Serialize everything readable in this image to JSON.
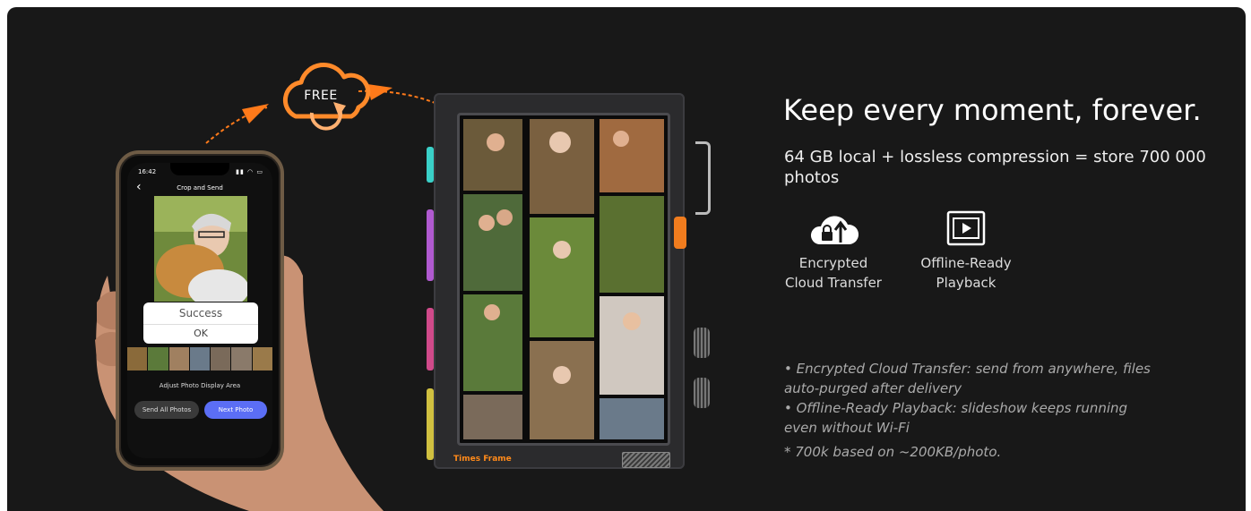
{
  "cloud": {
    "label": "FREE",
    "icon": "cloud-refresh-icon",
    "color": "#ff7a1a"
  },
  "phone": {
    "status_time": "16:42",
    "status_icons": "▮▮ ◠ ▭",
    "title": "Crop and Send",
    "dialog_title": "Success",
    "dialog_ok": "OK",
    "subtitle": "Adjust Photo Display Area",
    "send_all_label": "Send All Photos",
    "next_label": "Next Photo",
    "accent": "#5b6ef5"
  },
  "device": {
    "brand": "Times Frame"
  },
  "hero": {
    "headline": "Keep every moment, forever.",
    "subline": "64 GB local + lossless compression = store 700 000 photos"
  },
  "features": [
    {
      "icon": "cloud-lock-upload-icon",
      "line1": "Encrypted",
      "line2": "Cloud Transfer"
    },
    {
      "icon": "slideshow-play-icon",
      "line1": "Offline-Ready",
      "line2": "Playback"
    }
  ],
  "bullets": [
    "• Encrypted Cloud Transfer: send from anywhere, files auto-purged after delivery",
    "• Offline-Ready Playback: slideshow keeps running even without Wi-Fi"
  ],
  "footnote": "* 700k based on ~200KB/photo."
}
